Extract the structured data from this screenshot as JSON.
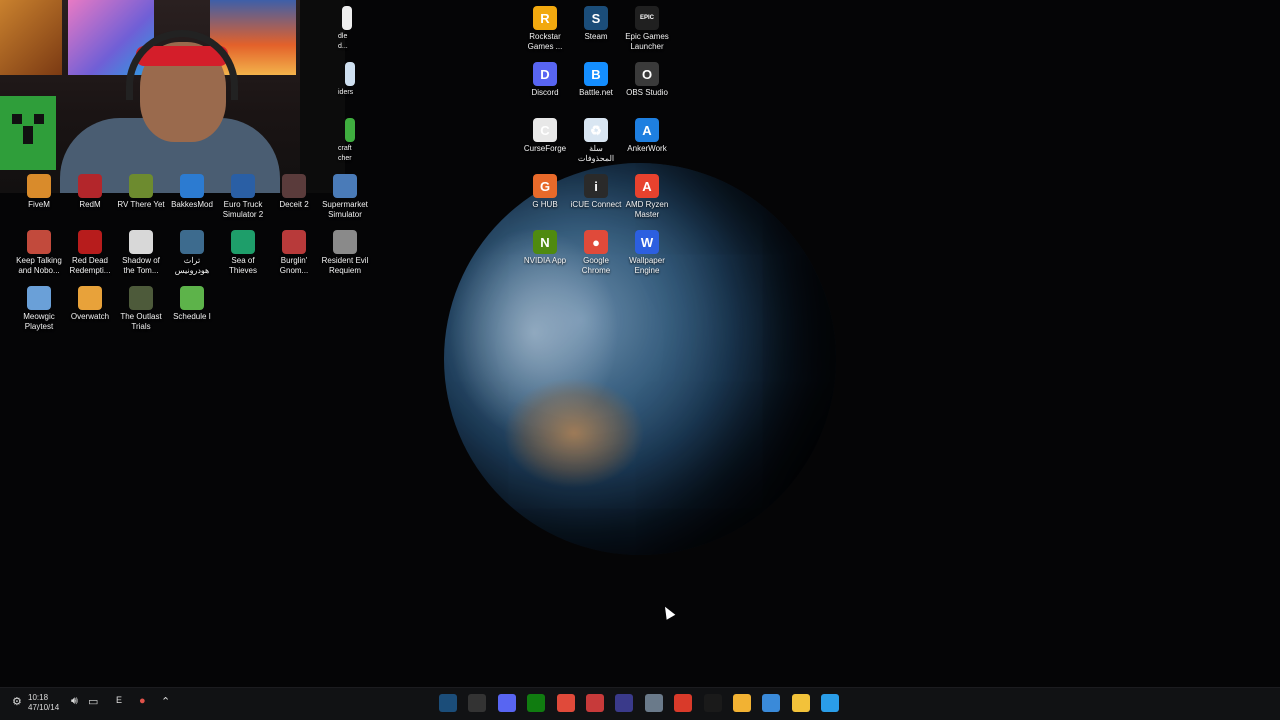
{
  "webcam": {
    "visible": true
  },
  "clipped_labels": {
    "a": "dle\nd...",
    "b": "iders",
    "c": "craft\ncher"
  },
  "desktop_icons_left": [
    {
      "label": "FiveM",
      "icon": "fivem-icon",
      "color": "#d98b2b"
    },
    {
      "label": "RedM",
      "icon": "redm-icon",
      "color": "#b3262b"
    },
    {
      "label": "RV There Yet",
      "icon": "rv-icon",
      "color": "#6d8b2f"
    },
    {
      "label": "BakkesMod",
      "icon": "bakkesmod-icon",
      "color": "#2c7bd1"
    },
    {
      "label": "Euro Truck\nSimulator 2",
      "icon": "truck-icon",
      "color": "#2a5fa5"
    },
    {
      "label": "Deceit 2",
      "icon": "deceit-icon",
      "color": "#5a3b3b"
    },
    {
      "label": "Supermarket\nSimulator",
      "icon": "supermarket-icon",
      "color": "#4a7bb8"
    },
    {
      "label": "Keep Talking\nand Nobo...",
      "icon": "bomb-icon",
      "color": "#c24a3c"
    },
    {
      "label": "Red Dead\nRedempti...",
      "icon": "rdr-icon",
      "color": "#b71c1c"
    },
    {
      "label": "Shadow of\nthe Tom...",
      "icon": "shadow-icon",
      "color": "#d8d8d8"
    },
    {
      "label": "تراث\nهودرونيس",
      "icon": "arabic-game-icon",
      "color": "#3d6b8e"
    },
    {
      "label": "Sea of\nThieves",
      "icon": "sea-of-thieves-icon",
      "color": "#1e9e6a"
    },
    {
      "label": "Burglin'\nGnom...",
      "icon": "gnome-icon",
      "color": "#b83a3a"
    },
    {
      "label": "Resident Evil\nRequiem",
      "icon": "resident-evil-icon",
      "color": "#8a8a8a"
    },
    {
      "label": "Meowgic\nPlaytest",
      "icon": "meowgic-icon",
      "color": "#6aa0d8"
    },
    {
      "label": "Overwatch",
      "icon": "overwatch-icon",
      "color": "#e8a23a"
    },
    {
      "label": "The Outlast\nTrials",
      "icon": "outlast-icon",
      "color": "#4d5a3a"
    },
    {
      "label": "Schedule I",
      "icon": "schedule-icon",
      "color": "#5db34a"
    }
  ],
  "desktop_icons_right": [
    {
      "label": "Rockstar\nGames ...",
      "icon": "rockstar-icon",
      "color": "#f2a90f",
      "text": "R"
    },
    {
      "label": "Steam",
      "icon": "steam-icon",
      "color": "#1b4d79",
      "text": "S"
    },
    {
      "label": "Epic Games\nLauncher",
      "icon": "epic-games-icon",
      "color": "#202020",
      "text": "EPIC"
    },
    {
      "label": "Discord",
      "icon": "discord-icon",
      "color": "#5865f2",
      "text": "D"
    },
    {
      "label": "Battle.net",
      "icon": "battlenet-icon",
      "color": "#148eff",
      "text": "B"
    },
    {
      "label": "OBS Studio",
      "icon": "obs-icon",
      "color": "#3a3a3a",
      "text": "O"
    },
    {
      "label": "CurseForge",
      "icon": "curseforge-icon",
      "color": "#e8e8e8",
      "text": "C"
    },
    {
      "label": "سلة\nالمحذوفات",
      "icon": "recycle-bin-icon",
      "color": "#d9e6f2",
      "text": "♻"
    },
    {
      "label": "AnkerWork",
      "icon": "ankerwork-icon",
      "color": "#1e7fe0",
      "text": "A"
    },
    {
      "label": "G HUB",
      "icon": "ghub-icon",
      "color": "#e86a2a",
      "text": "G"
    },
    {
      "label": "iCUE Connect",
      "icon": "icue-icon",
      "color": "#2a2a2a",
      "text": "i"
    },
    {
      "label": "AMD Ryzen\nMaster",
      "icon": "amd-ryzen-icon",
      "color": "#e8422e",
      "text": "A"
    },
    {
      "label": "NVIDIA App",
      "icon": "nvidia-icon",
      "color": "#4f8a10",
      "text": "N"
    },
    {
      "label": "Google\nChrome",
      "icon": "chrome-icon",
      "color": "#e04a3a",
      "text": "●"
    },
    {
      "label": "Wallpaper\nEngine",
      "icon": "wallpaper-engine-icon",
      "color": "#2c5fe0",
      "text": "W"
    }
  ],
  "taskbar": {
    "time": "10:18",
    "date": "47/10/14",
    "input_language": "E",
    "tray_icons": [
      "settings-icon",
      "volume-icon",
      "network-icon",
      "microphone-icon",
      "chevron-up-icon"
    ],
    "apps": [
      {
        "name": "steam",
        "icon": "steam-icon",
        "color": "#1b4d79"
      },
      {
        "name": "obs",
        "icon": "obs-icon",
        "color": "#333"
      },
      {
        "name": "discord",
        "icon": "discord-icon",
        "color": "#5865f2"
      },
      {
        "name": "xbox",
        "icon": "xbox-icon",
        "color": "#107c10"
      },
      {
        "name": "chrome",
        "icon": "chrome-icon",
        "color": "#e04a3a"
      },
      {
        "name": "task-manager",
        "icon": "monitor-icon",
        "color": "#c73a3a"
      },
      {
        "name": "arrow-app",
        "icon": "arrow-app-icon",
        "color": "#3a3a8a"
      },
      {
        "name": "settings",
        "icon": "gear-icon",
        "color": "#6a7a8a"
      },
      {
        "name": "amd",
        "icon": "amd-icon",
        "color": "#d93a2a"
      },
      {
        "name": "razer",
        "icon": "razer-icon",
        "color": "#1a1a1a"
      },
      {
        "name": "store",
        "icon": "store-icon",
        "color": "#f2b233"
      },
      {
        "name": "remote",
        "icon": "remote-desktop-icon",
        "color": "#3a8ad9"
      },
      {
        "name": "explorer",
        "icon": "folder-icon",
        "color": "#f2c23a"
      },
      {
        "name": "start",
        "icon": "windows-icon",
        "color": "#2a9de8"
      }
    ]
  }
}
